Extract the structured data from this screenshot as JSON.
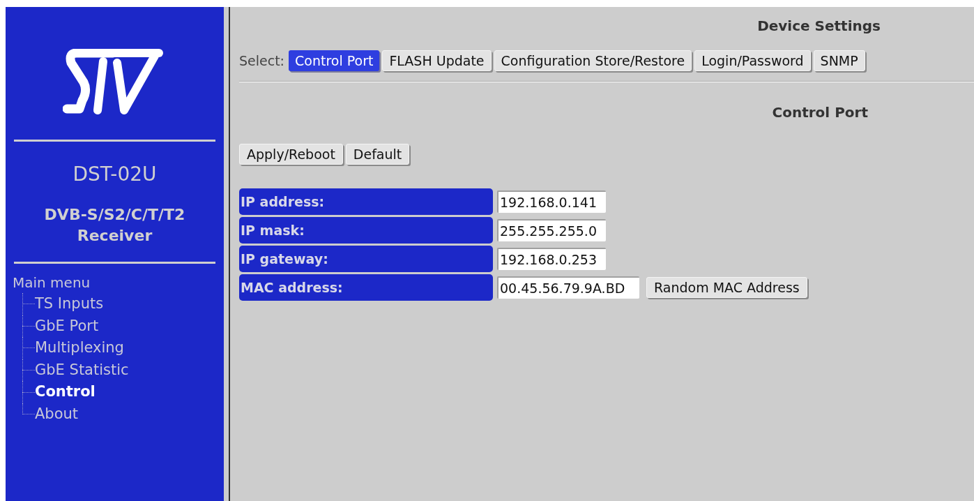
{
  "sidebar": {
    "model": "DST-02U",
    "description": "DVB-S/S2/C/T/T2 Receiver",
    "menu_title": "Main menu",
    "items": [
      {
        "label": "TS Inputs",
        "selected": false
      },
      {
        "label": "GbE Port",
        "selected": false
      },
      {
        "label": "Multiplexing",
        "selected": false
      },
      {
        "label": "GbE Statistic",
        "selected": false
      },
      {
        "label": "Control",
        "selected": true
      },
      {
        "label": "About",
        "selected": false
      }
    ]
  },
  "page_title": "Device Settings",
  "select_label": "Select:",
  "tabs": [
    {
      "label": "Control Port",
      "selected": true
    },
    {
      "label": "FLASH Update",
      "selected": false
    },
    {
      "label": "Configuration Store/Restore",
      "selected": false
    },
    {
      "label": "Login/Password",
      "selected": false
    },
    {
      "label": "SNMP",
      "selected": false
    }
  ],
  "section_title": "Control Port",
  "buttons": [
    "Apply/Reboot",
    "Default"
  ],
  "fields": [
    {
      "label": "IP address:",
      "value": "192.168.0.141"
    },
    {
      "label": "IP mask:",
      "value": "255.255.255.0"
    },
    {
      "label": "IP gateway:",
      "value": "192.168.0.253"
    },
    {
      "label": "MAC address:",
      "value": "00.45.56.79.9A.BD",
      "button": "Random MAC Address"
    }
  ]
}
